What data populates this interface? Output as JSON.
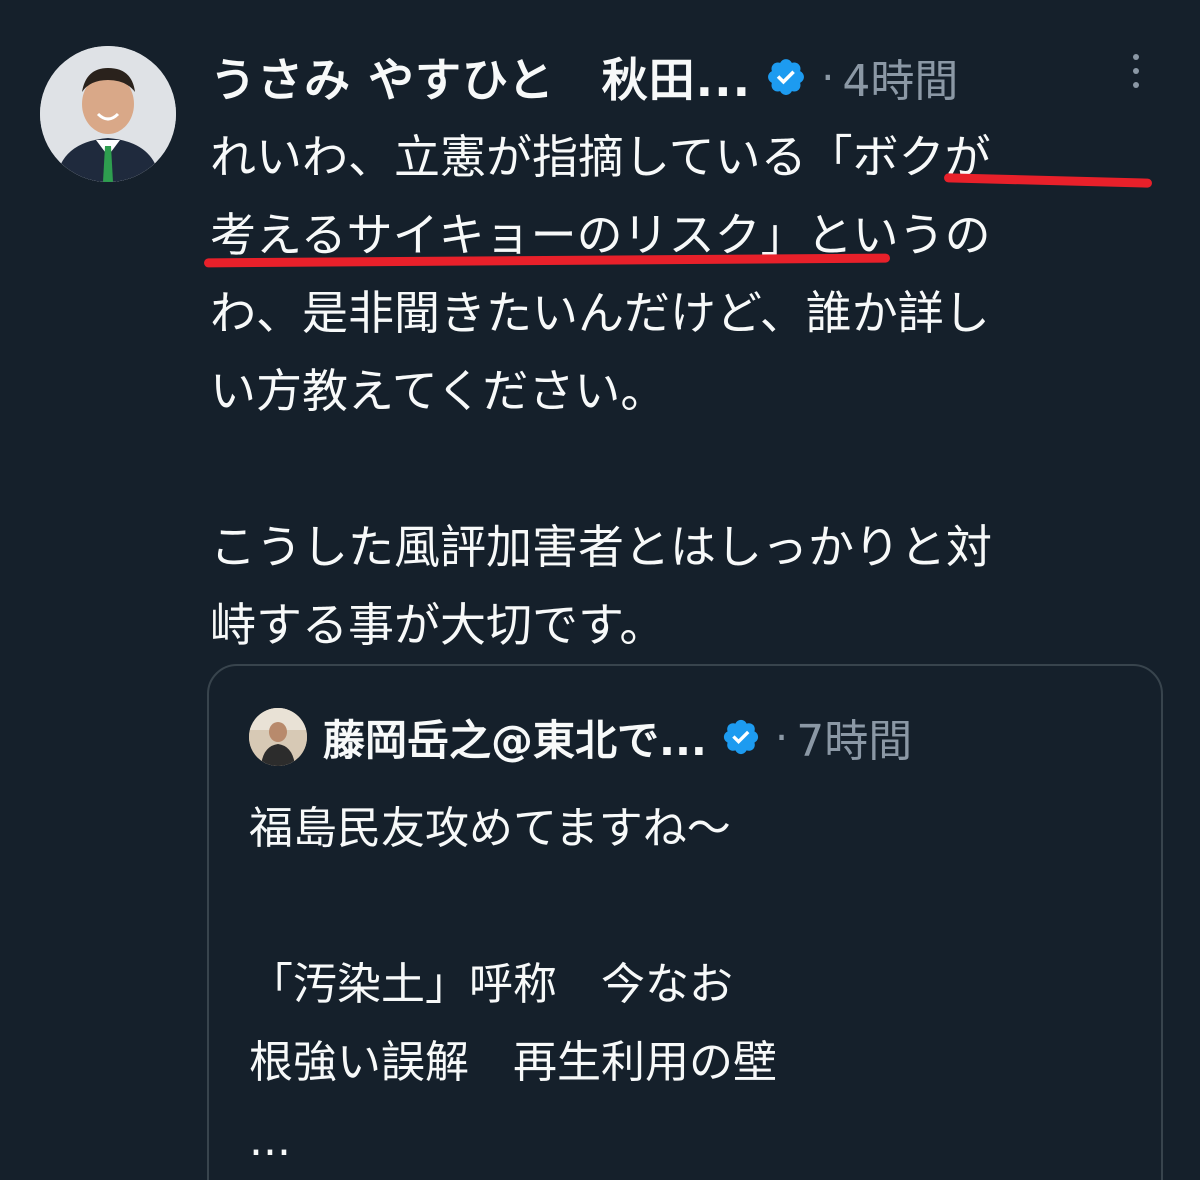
{
  "tweet": {
    "author_name": "うさみ やすひと　秋田...",
    "separator": "·",
    "time": "4時間",
    "body_lines": [
      "れいわ、立憲が指摘している「ボクが",
      "考えるサイキョーのリスク」というの",
      "わ、是非聞きたいんだけど、誰か詳し",
      "い方教えてください。",
      "",
      "こうした風評加害者とはしっかりと対",
      "峙する事が大切です。"
    ]
  },
  "quoted_tweet": {
    "author_name": "藤岡岳之@東北で...",
    "separator": "·",
    "time": "7時間",
    "body_lines": [
      "福島民友攻めてますね〜",
      "",
      "「汚染土」呼称　今なお",
      "根強い誤解　再生利用の壁",
      "..."
    ]
  },
  "colors": {
    "background": "#15202b",
    "text": "#f7f9f9",
    "secondary_text": "#8b98a5",
    "verified_badge": "#1d9bf0",
    "underline_annotation": "#e8202a",
    "quote_border": "#38444d"
  },
  "icons": {
    "verified": "verified-badge-icon",
    "more": "more-options-icon"
  }
}
